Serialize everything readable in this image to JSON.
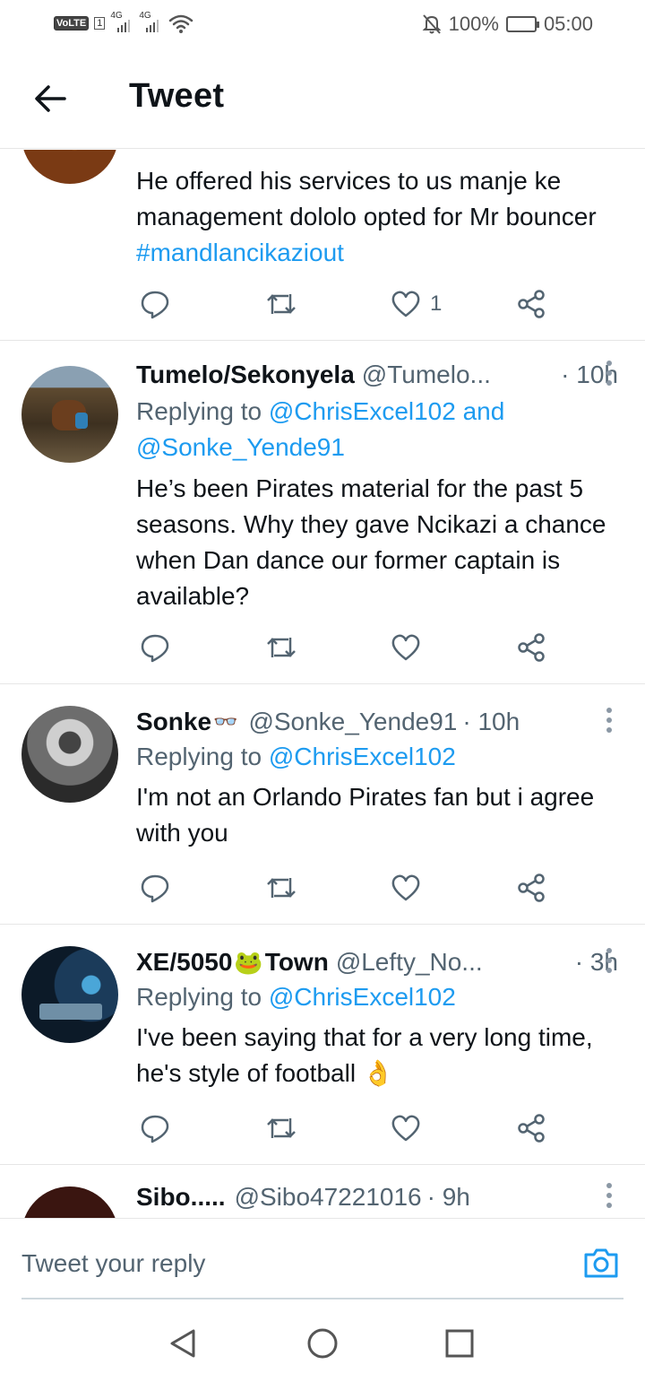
{
  "status_bar": {
    "volte": "VoLTE",
    "sim": "1",
    "net1": "4G",
    "net2": "4G",
    "battery_percent": "100%",
    "battery_level": 1.0,
    "time": "05:00"
  },
  "header": {
    "title": "Tweet"
  },
  "tweets": [
    {
      "body": "He offered his services to us manje ke management dololo opted for Mr bouncer ",
      "hashtag": "#mandlancikaziout",
      "like_count": "1"
    },
    {
      "name": "Tumelo/Sekonyela",
      "handle": "@Tumelo...",
      "time": "· 10h",
      "replying_prefix": "Replying to ",
      "mention1": "@ChrisExcel102",
      "mention_join": " and",
      "mention2": "@Sonke_Yende91",
      "body": "He’s been Pirates material for the past 5 seasons. Why they gave Ncikazi a chance when Dan dance our former captain is available?"
    },
    {
      "name": "Sonke",
      "name_emoji": "👓",
      "handle": "@Sonke_Yende91",
      "time": "· 10h",
      "replying_prefix": "Replying to ",
      "mention1": "@ChrisExcel102",
      "body": "I'm not an Orlando Pirates fan but i agree with you"
    },
    {
      "name_a": "XE/5050",
      "name_emoji": "🐸",
      "name_b": "Town",
      "handle": "@Lefty_No...",
      "time": "· 3h",
      "replying_prefix": "Replying to ",
      "mention1": "@ChrisExcel102",
      "body": "I've been saying that for a very long time, he's style of football ",
      "body_emoji": "👌"
    },
    {
      "name": "Sibo.....",
      "handle": "@Sibo47221016",
      "time": "· 9h"
    }
  ],
  "compose": {
    "placeholder": "Tweet your reply"
  },
  "icons": {
    "reply": "reply-icon",
    "retweet": "retweet-icon",
    "like": "heart-icon",
    "share": "share-icon",
    "more": "more-vertical-icon",
    "camera": "camera-icon"
  },
  "colors": {
    "accent": "#1d9bf0",
    "text": "#0f1419",
    "secondary": "#536471",
    "divider": "#e6e6e6"
  }
}
